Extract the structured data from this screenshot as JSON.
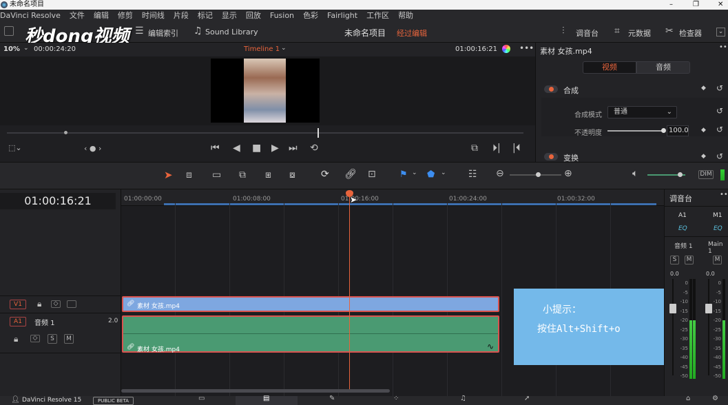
{
  "window": {
    "title": "未命名项目",
    "controls": [
      "–",
      "❐",
      "✕"
    ]
  },
  "menu": [
    "DaVinci Resolve",
    "文件",
    "编辑",
    "修剪",
    "时间线",
    "片段",
    "标记",
    "显示",
    "回放",
    "Fusion",
    "色彩",
    "Fairlight",
    "工作区",
    "帮助"
  ],
  "watermark": "秒dong视频",
  "toolbar": {
    "edit_index": "编辑索引",
    "sound_library": "Sound Library",
    "project_name": "未命名项目",
    "project_status": "经过编辑",
    "mixer": "调音台",
    "metadata": "元数据",
    "inspector": "检查器"
  },
  "viewer": {
    "zoom": "10%",
    "source_timecode": "00:00:24:20",
    "timeline_name": "Timeline 1",
    "timecode": "01:00:16:21"
  },
  "inspector": {
    "clip_name": "素材 女孩.mp4",
    "tab_video": "视频",
    "tab_audio": "音频",
    "section_composite": "合成",
    "composite_mode_label": "合成模式",
    "composite_mode_value": "普通",
    "opacity_label": "不透明度",
    "opacity_value": "100.0",
    "section_transform": "变换",
    "opacity_level": 1.0
  },
  "timeline": {
    "timecode": "01:00:16:21",
    "ruler": [
      "01:00:00:00",
      "01:00:08:00",
      "01:00:16:00",
      "01:00:24:00",
      "01:00:32:00"
    ],
    "v1_label": "V1",
    "a1_label": "A1",
    "a1_name": "音频 1",
    "a1_channels": "2.0",
    "video_clip": "素材 女孩.mp4",
    "audio_clip": "素材 女孩.mp4"
  },
  "tip": {
    "title": "小提示：",
    "body": "按住Alt+Shift+o"
  },
  "mixer": {
    "title": "调音台",
    "ch1": "A1",
    "ch2": "M1",
    "eq": "EQ",
    "ch1_name": "音频 1",
    "ch2_name": "Main 1",
    "s": "S",
    "m": "M",
    "gain1": "0.0",
    "gain2": "0.0",
    "scale": [
      "0",
      "-5",
      "-10",
      "-15",
      "-20",
      "-25",
      "-30",
      "-35",
      "-40",
      "-45",
      "-50"
    ]
  },
  "status": {
    "app": "DaVinci Resolve 15",
    "badge": "PUBLIC BETA"
  },
  "colors": {
    "accent_orange": "#e8643c",
    "video_clip": "#7ea7e0",
    "audio_clip": "#4a9a72",
    "tip_bg": "#74b9ea",
    "playhead": "#e8643c"
  }
}
